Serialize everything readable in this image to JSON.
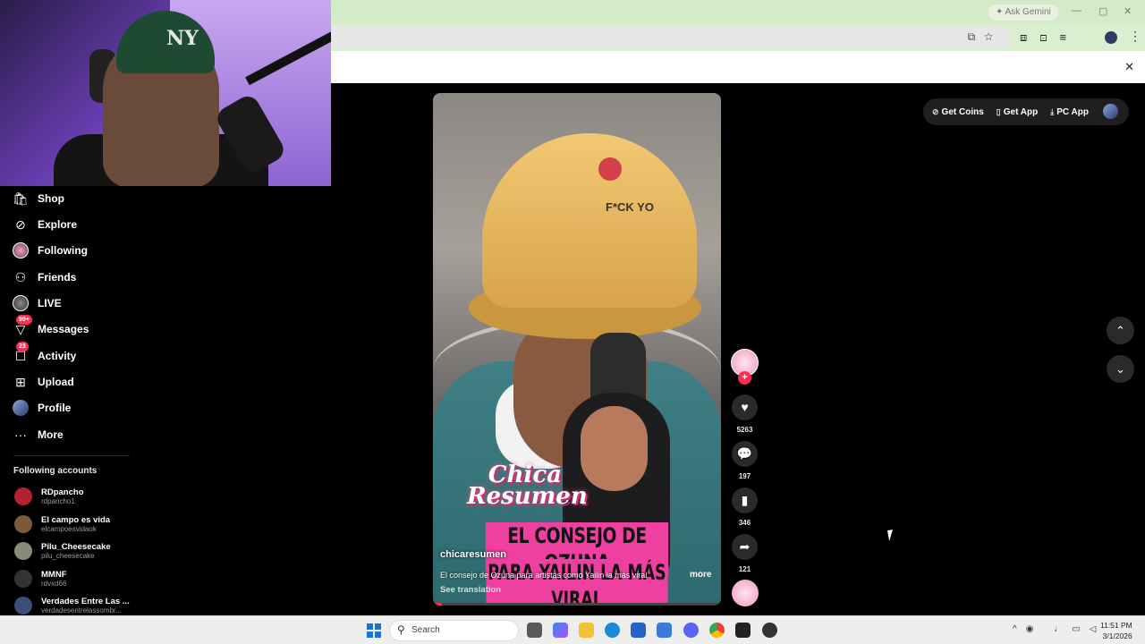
{
  "browser": {
    "gemini_label": "Ask Gemini",
    "window_min": "—",
    "window_max": "▢",
    "window_close": "✕",
    "infobar_close": "✕"
  },
  "webcam": {
    "cap_logo": "NY"
  },
  "sidebar": {
    "items": [
      {
        "label": "Shop",
        "icon": "shop-bag-icon",
        "glyph": "🛍"
      },
      {
        "label": "Explore",
        "icon": "compass-icon",
        "glyph": "⊘"
      },
      {
        "label": "Following",
        "icon": "avatar-following-icon",
        "glyph": ""
      },
      {
        "label": "Friends",
        "icon": "friends-icon",
        "glyph": "👥"
      },
      {
        "label": "LIVE",
        "icon": "live-avatar-icon",
        "glyph": ""
      },
      {
        "label": "Messages",
        "icon": "messages-icon",
        "glyph": "▽",
        "badge": "99+"
      },
      {
        "label": "Activity",
        "icon": "activity-icon",
        "glyph": "☐",
        "badge": "23"
      },
      {
        "label": "Upload",
        "icon": "upload-icon",
        "glyph": "⊞"
      },
      {
        "label": "Profile",
        "icon": "profile-avatar-icon",
        "glyph": ""
      },
      {
        "label": "More",
        "icon": "more-dots-icon",
        "glyph": "···"
      }
    ],
    "following_title": "Following accounts",
    "accounts": [
      {
        "name": "RDpancho",
        "handle": "rdpancho1",
        "color": "#b0232f"
      },
      {
        "name": "El campo es vida",
        "handle": "elcampoesvidaok",
        "color": "#7a5a3a"
      },
      {
        "name": "Pilu_Cheesecake",
        "handle": "pilu_cheesecake",
        "color": "#8a8a7a"
      },
      {
        "name": "MMNF",
        "handle": "rdvxd66",
        "color": "#333333"
      },
      {
        "name": "Verdades Entre Las ...",
        "handle": "verdadesentrelassombr...",
        "color": "#3a4f7a"
      }
    ]
  },
  "topbar": {
    "get_coins": "Get Coins",
    "get_app": "Get App",
    "pc_app": "PC App"
  },
  "video": {
    "hat_text": "F*CK YO",
    "brand": "Chica Resumen",
    "headline_line1": "EL CONSEJO DE OZUNA",
    "headline_line2": "PARA YAILIN LA MÁS VIRAL",
    "author": "chicaresumen",
    "caption": "El consejo de Ozuna para artistas como Yailin la más viral",
    "more": "more",
    "see_translation": "See translation",
    "progress": 0.03
  },
  "actions": {
    "likes": "5263",
    "comments": "197",
    "saves": "346",
    "shares": "121"
  },
  "taskbar": {
    "search_label": "Search",
    "time": "11:51 PM",
    "date": "3/1/2026"
  }
}
